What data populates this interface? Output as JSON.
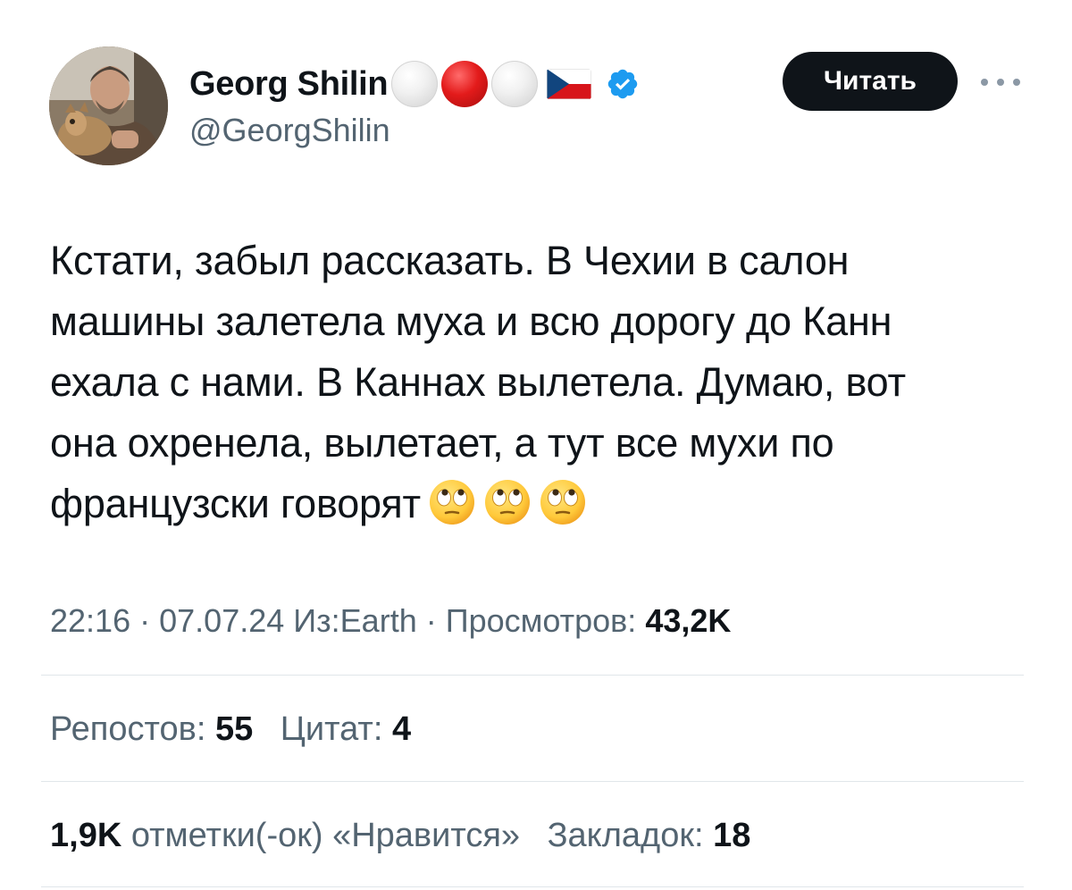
{
  "author": {
    "display_name": "Georg Shilin",
    "handle": "@GeorgShilin",
    "name_emojis": [
      "white-circle",
      "red-circle",
      "white-circle",
      "czech-flag"
    ],
    "verified": true,
    "verified_color": "#1d9bf0"
  },
  "follow_button": {
    "label": "Читать"
  },
  "tweet": {
    "text_lines": [
      "Кстати, забыл рассказать. В Чехии в салон",
      "машины залетела муха и всю дорогу до Канн",
      "ехала с нами. В Каннах вылетела. Думаю, вот",
      "она охренела, вылетает, а тут все мухи по",
      "французски говорят"
    ],
    "trailing_emojis": [
      "face-with-rolling-eyes",
      "face-with-rolling-eyes",
      "face-with-rolling-eyes"
    ]
  },
  "meta": {
    "time": "22:16",
    "date": "07.07.24",
    "source_prefix": "Из:",
    "source": "Earth",
    "views_label": "Просмотров:",
    "views_value": "43,2K",
    "separator": "·"
  },
  "engagement": {
    "reposts_label": "Репостов:",
    "reposts_value": "55",
    "quotes_label": "Цитат:",
    "quotes_value": "4",
    "likes_value": "1,9K",
    "likes_label": "отметки(-ок) «Нравится»",
    "bookmarks_label": "Закладок:",
    "bookmarks_value": "18"
  },
  "colors": {
    "text_primary": "#0f1419",
    "text_secondary": "#536471",
    "divider": "#e1e6ea",
    "button_bg": "#0f1419",
    "button_text": "#ffffff"
  }
}
